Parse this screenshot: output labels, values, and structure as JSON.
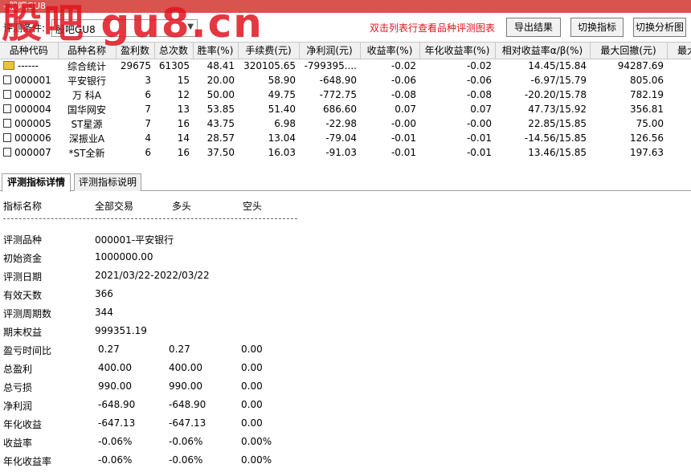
{
  "window": {
    "title": "- 股吧GU8"
  },
  "watermark": "股吧  gu8.cn",
  "toolbar": {
    "condition_label": "评测条件:",
    "condition_value": "股吧GU8",
    "hint": "双击列表行查看品种评测图表",
    "export_label": "导出结果",
    "switch_label": "切换指标",
    "chart_label": "切换分析图"
  },
  "grid": {
    "headers": [
      "品种代码",
      "品种名称",
      "盈利数",
      "总次数",
      "胜率(%)",
      "手续费(元)",
      "净利润(元)",
      "收益率(%)",
      "年化收益率(%)",
      "相对收益率α/β(%)",
      "最大回撤(元)",
      "最大"
    ],
    "rows": [
      {
        "code": "------",
        "name": "综合统计",
        "wins": "29675",
        "total": "61305",
        "winrate": "48.41",
        "fee": "320105.65",
        "profit": "-799395....",
        "ret": "-0.02",
        "annual": "-0.02",
        "rel": "14.45/15.84",
        "mdd": "94287.69",
        "summary": true
      },
      {
        "code": "000001",
        "name": "平安银行",
        "wins": "3",
        "total": "15",
        "winrate": "20.00",
        "fee": "58.90",
        "profit": "-648.90",
        "ret": "-0.06",
        "annual": "-0.06",
        "rel": "-6.97/15.79",
        "mdd": "805.06"
      },
      {
        "code": "000002",
        "name": "万 科A",
        "wins": "6",
        "total": "12",
        "winrate": "50.00",
        "fee": "49.75",
        "profit": "-772.75",
        "ret": "-0.08",
        "annual": "-0.08",
        "rel": "-20.20/15.78",
        "mdd": "782.19"
      },
      {
        "code": "000004",
        "name": "国华网安",
        "wins": "7",
        "total": "13",
        "winrate": "53.85",
        "fee": "51.40",
        "profit": "686.60",
        "ret": "0.07",
        "annual": "0.07",
        "rel": "47.73/15.92",
        "mdd": "356.81"
      },
      {
        "code": "000005",
        "name": "ST星源",
        "wins": "7",
        "total": "16",
        "winrate": "43.75",
        "fee": "6.98",
        "profit": "-22.98",
        "ret": "-0.00",
        "annual": "-0.00",
        "rel": "22.85/15.85",
        "mdd": "75.00"
      },
      {
        "code": "000006",
        "name": "深振业A",
        "wins": "4",
        "total": "14",
        "winrate": "28.57",
        "fee": "13.04",
        "profit": "-79.04",
        "ret": "-0.01",
        "annual": "-0.01",
        "rel": "-14.56/15.85",
        "mdd": "126.56"
      },
      {
        "code": "000007",
        "name": "*ST全新",
        "wins": "6",
        "total": "16",
        "winrate": "37.50",
        "fee": "16.03",
        "profit": "-91.03",
        "ret": "-0.01",
        "annual": "-0.01",
        "rel": "13.46/15.85",
        "mdd": "197.63"
      }
    ]
  },
  "tabs": [
    "评测指标详情",
    "评测指标说明"
  ],
  "details": {
    "header": {
      "name": "指标名称",
      "all": "全部交易",
      "long": "多头",
      "short": "空头"
    },
    "separator": "------------------------------------------------------------------------",
    "rows": [
      {
        "label": "评测品种",
        "all": "000001-平安银行",
        "long": "",
        "short": ""
      },
      {
        "label": "初始资金",
        "all": "1000000.00",
        "long": "",
        "short": ""
      },
      {
        "label": "评测日期",
        "all": "2021/03/22-2022/03/22",
        "long": "",
        "short": ""
      },
      {
        "label": "有效天数",
        "all": "366",
        "long": "",
        "short": ""
      },
      {
        "label": "评测周期数",
        "all": "344",
        "long": "",
        "short": ""
      },
      {
        "label": "期末权益",
        "all": "999351.19",
        "long": "",
        "short": ""
      },
      {
        "label": "盈亏时间比",
        "all": "0.27",
        "long": "0.27",
        "short": "0.00"
      },
      {
        "label": "总盈利",
        "all": "400.00",
        "long": "400.00",
        "short": "0.00"
      },
      {
        "label": "总亏损",
        "all": "990.00",
        "long": "990.00",
        "short": "0.00"
      },
      {
        "label": "净利润",
        "all": "-648.90",
        "long": "-648.90",
        "short": "0.00"
      },
      {
        "label": "年化收益",
        "all": "-647.13",
        "long": "-647.13",
        "short": "0.00"
      },
      {
        "label": "收益率",
        "all": "-0.06%",
        "long": "-0.06%",
        "short": "0.00%"
      },
      {
        "label": "年化收益率",
        "all": "-0.06%",
        "long": "-0.06%",
        "short": "0.00%"
      }
    ]
  }
}
